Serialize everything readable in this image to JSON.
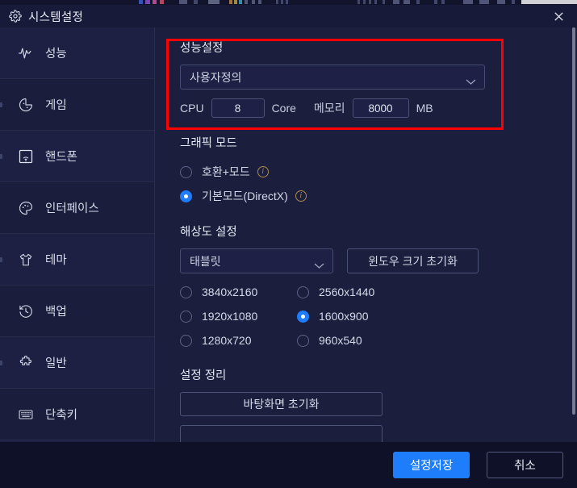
{
  "window": {
    "title": "시스템설정",
    "gear_icon": "gear-icon",
    "close_icon": "close-icon"
  },
  "sidebar": {
    "items": [
      {
        "label": "성능",
        "icon": "activity-pulse-icon"
      },
      {
        "label": "게임",
        "icon": "gamepad-icon"
      },
      {
        "label": "핸드폰",
        "icon": "phone-signal-icon"
      },
      {
        "label": "인터페이스",
        "icon": "palette-icon"
      },
      {
        "label": "테마",
        "icon": "tshirt-icon"
      },
      {
        "label": "백업",
        "icon": "history-clock-icon"
      },
      {
        "label": "일반",
        "icon": "puzzle-piece-icon"
      },
      {
        "label": "단축키",
        "icon": "keyboard-icon"
      }
    ]
  },
  "performance": {
    "section_title": "성능설정",
    "profile_value": "사용자정의",
    "cpu_label": "CPU",
    "cpu_value": "8",
    "cpu_unit": "Core",
    "memory_label": "메모리",
    "memory_value": "8000",
    "memory_unit": "MB"
  },
  "graphics": {
    "section_title": "그래픽 모드",
    "options": [
      {
        "label": "호환+모드",
        "selected": false,
        "info": "i"
      },
      {
        "label": "기본모드(DirectX)",
        "selected": true,
        "info": "i"
      }
    ]
  },
  "resolution": {
    "section_title": "해상도 설정",
    "preset_value": "태블릿",
    "reset_window_label": "윈도우 크기 초기화",
    "options": [
      {
        "label": "3840x2160",
        "selected": false
      },
      {
        "label": "2560x1440",
        "selected": false
      },
      {
        "label": "1920x1080",
        "selected": false
      },
      {
        "label": "1600x900",
        "selected": true
      },
      {
        "label": "1280x720",
        "selected": false
      },
      {
        "label": "960x540",
        "selected": false
      }
    ]
  },
  "cleanup": {
    "section_title": "설정 정리",
    "buttons": [
      {
        "label": "바탕화면 초기화"
      },
      {
        "label": ""
      }
    ]
  },
  "footer": {
    "save_label": "설정저장",
    "cancel_label": "취소"
  },
  "colors": {
    "accent": "#1e7dfb",
    "annotation": "#ff0000",
    "info": "#a98a4e",
    "panel_bg": "#1b1e3d",
    "sidebar_bg": "#1d2042",
    "footer_bg": "#0f1129"
  }
}
